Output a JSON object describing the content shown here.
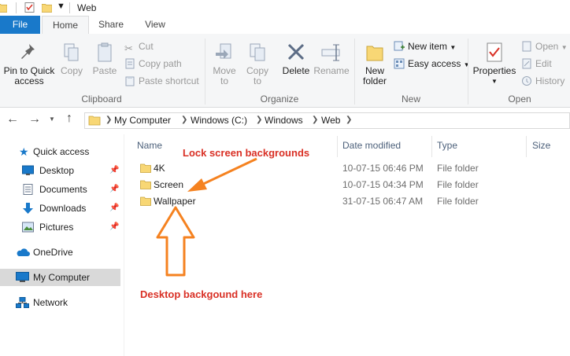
{
  "window": {
    "title": "Web"
  },
  "tabs": [
    {
      "label": "File"
    },
    {
      "label": "Home"
    },
    {
      "label": "Share"
    },
    {
      "label": "View"
    }
  ],
  "ribbon": {
    "clipboard": {
      "label": "Clipboard",
      "pin": "Pin to Quick access",
      "pin_l1": "Pin to Quick",
      "pin_l2": "access",
      "copy": "Copy",
      "paste": "Paste",
      "cut": "Cut",
      "copy_path": "Copy path",
      "paste_shortcut": "Paste shortcut"
    },
    "organize": {
      "label": "Organize",
      "move_l1": "Move",
      "move_l2": "to",
      "copy_l1": "Copy",
      "copy_l2": "to",
      "delete": "Delete",
      "rename": "Rename"
    },
    "new": {
      "label": "New",
      "folder_l1": "New",
      "folder_l2": "folder",
      "new_item": "New item",
      "easy_access": "Easy access"
    },
    "open": {
      "label": "Open",
      "properties": "Properties",
      "open": "Open",
      "edit": "Edit",
      "history": "History"
    }
  },
  "address": {
    "crumbs": [
      "My Computer",
      "Windows (C:)",
      "Windows",
      "Web"
    ]
  },
  "navpane": {
    "items": [
      {
        "label": "Quick access"
      },
      {
        "label": "Desktop"
      },
      {
        "label": "Documents"
      },
      {
        "label": "Downloads"
      },
      {
        "label": "Pictures"
      },
      {
        "label": "OneDrive"
      },
      {
        "label": "My Computer"
      },
      {
        "label": "Network"
      }
    ]
  },
  "filelist": {
    "columns": [
      "Name",
      "Date modified",
      "Type",
      "Size"
    ],
    "rows": [
      {
        "name": "4K",
        "date": "10-07-15 06:46 PM",
        "type": "File folder"
      },
      {
        "name": "Screen",
        "date": "10-07-15 04:34 PM",
        "type": "File folder"
      },
      {
        "name": "Wallpaper",
        "date": "31-07-15 06:47 AM",
        "type": "File folder"
      }
    ]
  },
  "annotations": {
    "lock": "Lock screen backgrounds",
    "desktop": "Desktop backgound here"
  },
  "colors": {
    "file_tab": "#1979ca",
    "annotation_text": "#d93025",
    "arrow": "#f58220",
    "selected_nav": "#d9d9d9",
    "folder": "#f8d775"
  }
}
